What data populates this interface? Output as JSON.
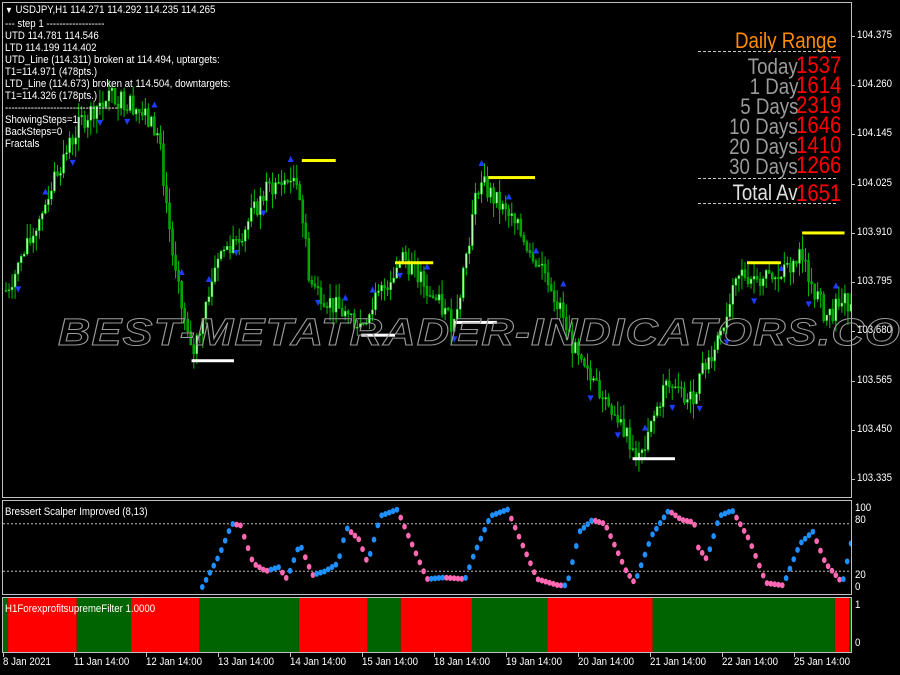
{
  "header": {
    "symbol_line": "USDJPY,H1  114.271 114.292 114.235 114.265",
    "collapse_icon": "triangle-down-icon"
  },
  "info_lines": [
    "---   step 1   ------------------",
    "UTD 114.781  114.546",
    "LTD  114.199  114.402",
    "UTD_Line (114.311) broken at 114.494, uptargets:",
    "T1=114.971 (478pts.)",
    "LTD_Line (114.673) broken at 114.504, downtargets:",
    "T1=114.326 (178pts.)",
    "-----------------------------------",
    "ShowingSteps=1",
    "BackSteps=0",
    "Fractals"
  ],
  "daily_range": {
    "title": "Daily Range",
    "rows": [
      {
        "label": "Today",
        "value": "1537"
      },
      {
        "label": "1 Day",
        "value": "1614"
      },
      {
        "label": "5 Days",
        "value": "2319"
      },
      {
        "label": "10 Days",
        "value": "1646"
      },
      {
        "label": "20 Days",
        "value": "1410"
      },
      {
        "label": "30 Days",
        "value": "1266"
      }
    ],
    "total_label": "Total Av",
    "total_value": "1651",
    "title_color": "#ff8c00",
    "value_color": "#ff0000",
    "label_color": "#9a9a9a"
  },
  "watermark": "BEST-METATRADER-INDICATORS.COM",
  "price_axis": {
    "labels": [
      "104.375",
      "104.260",
      "104.145",
      "104.025",
      "103.910",
      "103.795",
      "103.680",
      "103.565",
      "103.450",
      "103.335"
    ],
    "min": 103.335,
    "max": 104.375
  },
  "oscillator": {
    "title": "Bressert Scalper Improved (8,13)",
    "levels": [
      "100",
      "80",
      "20",
      "0"
    ],
    "rising_color": "#1e90ff",
    "falling_color": "#ff69b4"
  },
  "filter": {
    "title": "H1ForexprofitsupremeFilter 1.0000",
    "levels": [
      "1",
      "0"
    ],
    "colors": {
      "up": "#006400",
      "down": "#ff0000"
    },
    "segments": [
      {
        "state": "up",
        "from": 0.0,
        "to": 0.006
      },
      {
        "state": "down",
        "from": 0.006,
        "to": 0.087
      },
      {
        "state": "up",
        "from": 0.087,
        "to": 0.151
      },
      {
        "state": "down",
        "from": 0.151,
        "to": 0.232
      },
      {
        "state": "up",
        "from": 0.232,
        "to": 0.349
      },
      {
        "state": "down",
        "from": 0.349,
        "to": 0.43
      },
      {
        "state": "up",
        "from": 0.43,
        "to": 0.469
      },
      {
        "state": "down",
        "from": 0.469,
        "to": 0.553
      },
      {
        "state": "up",
        "from": 0.553,
        "to": 0.642
      },
      {
        "state": "down",
        "from": 0.642,
        "to": 0.766
      },
      {
        "state": "up",
        "from": 0.766,
        "to": 0.981
      },
      {
        "state": "down",
        "from": 0.981,
        "to": 0.998
      },
      {
        "state": "up",
        "from": 0.998,
        "to": 1.0
      }
    ]
  },
  "time_axis": {
    "labels": [
      "8 Jan 2021",
      "11 Jan 14:00",
      "12 Jan 14:00",
      "13 Jan 14:00",
      "14 Jan 14:00",
      "15 Jan 14:00",
      "18 Jan 14:00",
      "19 Jan 14:00",
      "20 Jan 14:00",
      "21 Jan 14:00",
      "22 Jan 14:00",
      "25 Jan 14:00"
    ]
  },
  "chart_data": {
    "type": "candlestick",
    "symbol": "USDJPY",
    "timeframe": "H1",
    "ylim": [
      103.335,
      104.375
    ],
    "close_path": [
      {
        "t": 0.0,
        "p": 103.78
      },
      {
        "t": 0.03,
        "p": 103.9
      },
      {
        "t": 0.06,
        "p": 104.06
      },
      {
        "t": 0.09,
        "p": 104.18
      },
      {
        "t": 0.12,
        "p": 104.24
      },
      {
        "t": 0.15,
        "p": 104.22
      },
      {
        "t": 0.18,
        "p": 104.15
      },
      {
        "t": 0.2,
        "p": 103.82
      },
      {
        "t": 0.22,
        "p": 103.62
      },
      {
        "t": 0.25,
        "p": 103.86
      },
      {
        "t": 0.28,
        "p": 103.92
      },
      {
        "t": 0.31,
        "p": 104.02
      },
      {
        "t": 0.345,
        "p": 104.05
      },
      {
        "t": 0.36,
        "p": 103.8
      },
      {
        "t": 0.39,
        "p": 103.74
      },
      {
        "t": 0.42,
        "p": 103.7
      },
      {
        "t": 0.47,
        "p": 103.86
      },
      {
        "t": 0.5,
        "p": 103.78
      },
      {
        "t": 0.53,
        "p": 103.7
      },
      {
        "t": 0.56,
        "p": 104.04
      },
      {
        "t": 0.6,
        "p": 103.94
      },
      {
        "t": 0.64,
        "p": 103.82
      },
      {
        "t": 0.68,
        "p": 103.6
      },
      {
        "t": 0.72,
        "p": 103.5
      },
      {
        "t": 0.75,
        "p": 103.38
      },
      {
        "t": 0.78,
        "p": 103.56
      },
      {
        "t": 0.81,
        "p": 103.52
      },
      {
        "t": 0.84,
        "p": 103.66
      },
      {
        "t": 0.87,
        "p": 103.82
      },
      {
        "t": 0.91,
        "p": 103.8
      },
      {
        "t": 0.94,
        "p": 103.86
      },
      {
        "t": 0.97,
        "p": 103.72
      },
      {
        "t": 1.0,
        "p": 103.76
      }
    ],
    "target_lines": [
      {
        "color": "white",
        "price": 103.615,
        "from": 0.22,
        "to": 0.27
      },
      {
        "color": "yellow",
        "price": 104.085,
        "from": 0.35,
        "to": 0.39
      },
      {
        "color": "white",
        "price": 103.675,
        "from": 0.42,
        "to": 0.46
      },
      {
        "color": "yellow",
        "price": 103.845,
        "from": 0.46,
        "to": 0.505
      },
      {
        "color": "white",
        "price": 103.705,
        "from": 0.53,
        "to": 0.58
      },
      {
        "color": "yellow",
        "price": 104.045,
        "from": 0.57,
        "to": 0.625
      },
      {
        "color": "white",
        "price": 103.385,
        "from": 0.74,
        "to": 0.79
      },
      {
        "color": "yellow",
        "price": 103.845,
        "from": 0.875,
        "to": 0.915
      },
      {
        "color": "yellow",
        "price": 103.915,
        "from": 0.94,
        "to": 0.99
      }
    ],
    "oscillator_path": [
      {
        "t": 0.235,
        "v": 0
      },
      {
        "t": 0.255,
        "v": 40
      },
      {
        "t": 0.27,
        "v": 80
      },
      {
        "t": 0.28,
        "v": 78
      },
      {
        "t": 0.295,
        "v": 30
      },
      {
        "t": 0.31,
        "v": 20
      },
      {
        "t": 0.325,
        "v": 25
      },
      {
        "t": 0.335,
        "v": 10
      },
      {
        "t": 0.35,
        "v": 55
      },
      {
        "t": 0.365,
        "v": 15
      },
      {
        "t": 0.38,
        "v": 20
      },
      {
        "t": 0.395,
        "v": 30
      },
      {
        "t": 0.405,
        "v": 75
      },
      {
        "t": 0.42,
        "v": 60
      },
      {
        "t": 0.43,
        "v": 30
      },
      {
        "t": 0.445,
        "v": 90
      },
      {
        "t": 0.465,
        "v": 98
      },
      {
        "t": 0.48,
        "v": 60
      },
      {
        "t": 0.5,
        "v": 10
      },
      {
        "t": 0.52,
        "v": 12
      },
      {
        "t": 0.545,
        "v": 10
      },
      {
        "t": 0.555,
        "v": 40
      },
      {
        "t": 0.575,
        "v": 90
      },
      {
        "t": 0.595,
        "v": 98
      },
      {
        "t": 0.61,
        "v": 60
      },
      {
        "t": 0.63,
        "v": 10
      },
      {
        "t": 0.655,
        "v": 2
      },
      {
        "t": 0.665,
        "v": 2
      },
      {
        "t": 0.68,
        "v": 70
      },
      {
        "t": 0.695,
        "v": 85
      },
      {
        "t": 0.71,
        "v": 80
      },
      {
        "t": 0.735,
        "v": 20
      },
      {
        "t": 0.745,
        "v": 5
      },
      {
        "t": 0.765,
        "v": 65
      },
      {
        "t": 0.785,
        "v": 97
      },
      {
        "t": 0.8,
        "v": 85
      },
      {
        "t": 0.815,
        "v": 82
      },
      {
        "t": 0.82,
        "v": 50
      },
      {
        "t": 0.83,
        "v": 35
      },
      {
        "t": 0.845,
        "v": 90
      },
      {
        "t": 0.86,
        "v": 97
      },
      {
        "t": 0.88,
        "v": 60
      },
      {
        "t": 0.9,
        "v": 5
      },
      {
        "t": 0.92,
        "v": 2
      },
      {
        "t": 0.94,
        "v": 55
      },
      {
        "t": 0.955,
        "v": 70
      },
      {
        "t": 0.97,
        "v": 30
      },
      {
        "t": 0.99,
        "v": 5
      },
      {
        "t": 1.0,
        "v": 55
      }
    ]
  }
}
